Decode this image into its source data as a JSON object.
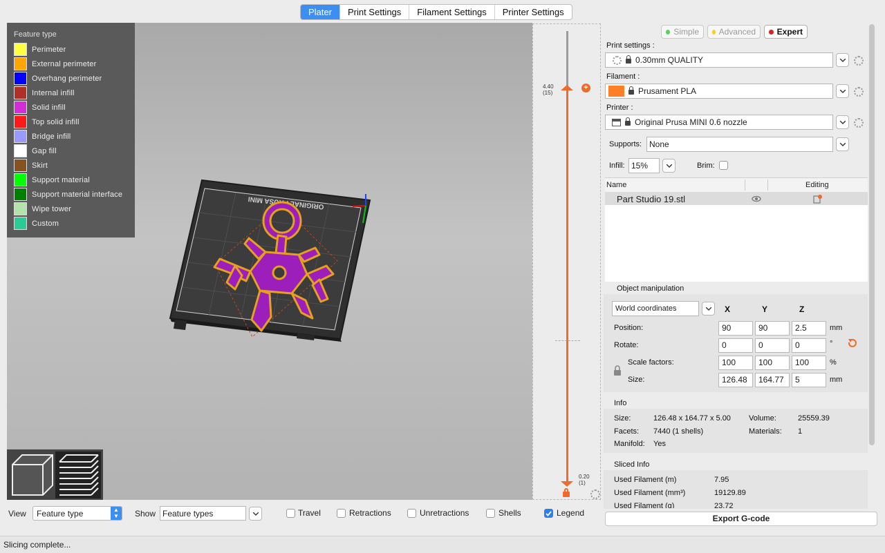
{
  "tabs": [
    {
      "label": "Plater",
      "active": true
    },
    {
      "label": "Print Settings",
      "active": false
    },
    {
      "label": "Filament Settings",
      "active": false
    },
    {
      "label": "Printer Settings",
      "active": false
    }
  ],
  "legend": {
    "title": "Feature type",
    "items": [
      {
        "label": "Perimeter",
        "color": "#ffff40"
      },
      {
        "label": "External perimeter",
        "color": "#ffa500"
      },
      {
        "label": "Overhang perimeter",
        "color": "#0000ff"
      },
      {
        "label": "Internal infill",
        "color": "#b03029"
      },
      {
        "label": "Solid infill",
        "color": "#d22dd6"
      },
      {
        "label": "Top solid infill",
        "color": "#ff1a1a"
      },
      {
        "label": "Bridge infill",
        "color": "#9999ff"
      },
      {
        "label": "Gap fill",
        "color": "#ffffff"
      },
      {
        "label": "Skirt",
        "color": "#845321"
      },
      {
        "label": "Support material",
        "color": "#00ff00"
      },
      {
        "label": "Support material interface",
        "color": "#008000"
      },
      {
        "label": "Wipe tower",
        "color": "#b3e3ab"
      },
      {
        "label": "Custom",
        "color": "#28cc94"
      }
    ]
  },
  "bed_label": "ORIGINAL PRUSA MINI",
  "slider": {
    "top_value": "4.40",
    "top_layer": "(15)",
    "bottom_value": "0.20",
    "bottom_layer": "(1)"
  },
  "modes": [
    {
      "label": "Simple",
      "color": "#5bd15b"
    },
    {
      "label": "Advanced",
      "color": "#f5d024"
    },
    {
      "label": "Expert",
      "color": "#e02020"
    }
  ],
  "print_settings": {
    "label": "Print settings :",
    "value": "0.30mm QUALITY"
  },
  "filament": {
    "label": "Filament :",
    "value": "Prusament PLA",
    "color": "#ff7f27"
  },
  "printer": {
    "label": "Printer :",
    "value": "Original Prusa MINI 0.6 nozzle"
  },
  "supports": {
    "label": "Supports:",
    "value": "None"
  },
  "infill": {
    "label": "Infill:",
    "value": "15%"
  },
  "brim": {
    "label": "Brim:"
  },
  "object_list": {
    "col_name": "Name",
    "col_editing": "Editing",
    "rows": [
      {
        "name": "Part Studio 19.stl"
      }
    ]
  },
  "manipulation": {
    "title": "Object manipulation",
    "coords": "World coordinates",
    "axes": [
      "X",
      "Y",
      "Z"
    ],
    "position": {
      "label": "Position:",
      "x": "90",
      "y": "90",
      "z": "2.5",
      "unit": "mm"
    },
    "rotate": {
      "label": "Rotate:",
      "x": "0",
      "y": "0",
      "z": "0",
      "unit": "°"
    },
    "scale": {
      "label": "Scale factors:",
      "x": "100",
      "y": "100",
      "z": "100",
      "unit": "%"
    },
    "size": {
      "label": "Size:",
      "x": "126.48",
      "y": "164.77",
      "z": "5",
      "unit": "mm"
    }
  },
  "info": {
    "title": "Info",
    "size_label": "Size:",
    "size": "126.48 x 164.77 x 5.00",
    "volume_label": "Volume:",
    "volume": "25559.39",
    "facets_label": "Facets:",
    "facets": "7440 (1 shells)",
    "materials_label": "Materials:",
    "materials": "1",
    "manifold_label": "Manifold:",
    "manifold": "Yes"
  },
  "sliced": {
    "title": "Sliced Info",
    "rows": [
      {
        "label": "Used Filament (m)",
        "value": "7.95"
      },
      {
        "label": "Used Filament (mm³)",
        "value": "19129.89"
      },
      {
        "label": "Used Filament (g)",
        "value": "23.72"
      }
    ]
  },
  "bottom": {
    "view_label": "View",
    "view_value": "Feature type",
    "show_label": "Show",
    "show_value": "Feature types",
    "checks": [
      {
        "label": "Travel",
        "checked": false
      },
      {
        "label": "Retractions",
        "checked": false
      },
      {
        "label": "Unretractions",
        "checked": false
      },
      {
        "label": "Shells",
        "checked": false
      },
      {
        "label": "Legend",
        "checked": true
      }
    ]
  },
  "export_label": "Export G-code",
  "status": "Slicing complete..."
}
